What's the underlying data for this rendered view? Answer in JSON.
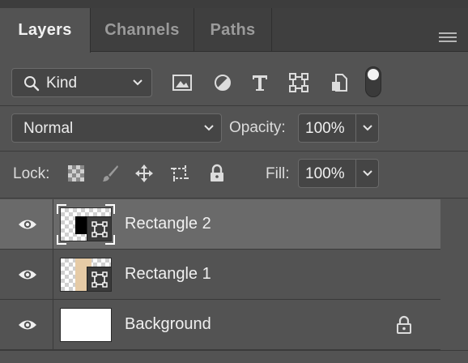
{
  "tabs": [
    {
      "label": "Layers",
      "active": true
    },
    {
      "label": "Channels",
      "active": false
    },
    {
      "label": "Paths",
      "active": false
    }
  ],
  "filter": {
    "kind_label": "Kind",
    "icons": [
      "image-filter-icon",
      "adjustment-filter-icon",
      "type-filter-icon",
      "shape-filter-icon",
      "smart-object-filter-icon"
    ],
    "toggle_on": true
  },
  "blend": {
    "mode": "Normal",
    "opacity_label": "Opacity:",
    "opacity_value": "100%"
  },
  "lock": {
    "label": "Lock:",
    "icons": [
      "lock-transparent-pixels-icon",
      "lock-image-pixels-icon",
      "lock-position-icon",
      "lock-artboard-icon",
      "lock-all-icon"
    ],
    "fill_label": "Fill:",
    "fill_value": "100%"
  },
  "layers": [
    {
      "name": "Rectangle 2",
      "selected": true,
      "visible": true,
      "type": "shape",
      "fill_color": "#000000",
      "locked": false
    },
    {
      "name": "Rectangle 1",
      "selected": false,
      "visible": true,
      "type": "shape",
      "fill_color": "#e6cba6",
      "locked": false
    },
    {
      "name": "Background",
      "selected": false,
      "visible": true,
      "type": "background",
      "fill_color": "#ffffff",
      "locked": true
    }
  ],
  "colors": {
    "panel_bg": "#535353",
    "selected_row": "#6a6a6a",
    "tabbar_bg": "#3f3f3f"
  }
}
